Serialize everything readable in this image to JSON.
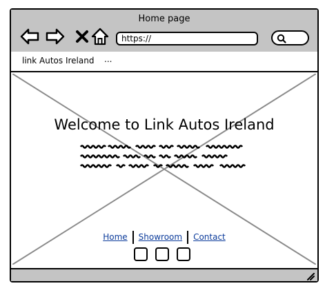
{
  "window": {
    "title": "Home page"
  },
  "toolbar": {
    "url": "https://",
    "icons": [
      "back-arrow-icon",
      "forward-arrow-icon",
      "close-icon",
      "home-icon",
      "search-icon"
    ]
  },
  "tabs": {
    "link_label": "link Autos Ireland",
    "more_label": "..."
  },
  "main": {
    "headline": "Welcome to Link Autos Ireland",
    "nav": {
      "home": "Home",
      "showroom": "Showroom",
      "contact": "Contact"
    }
  }
}
